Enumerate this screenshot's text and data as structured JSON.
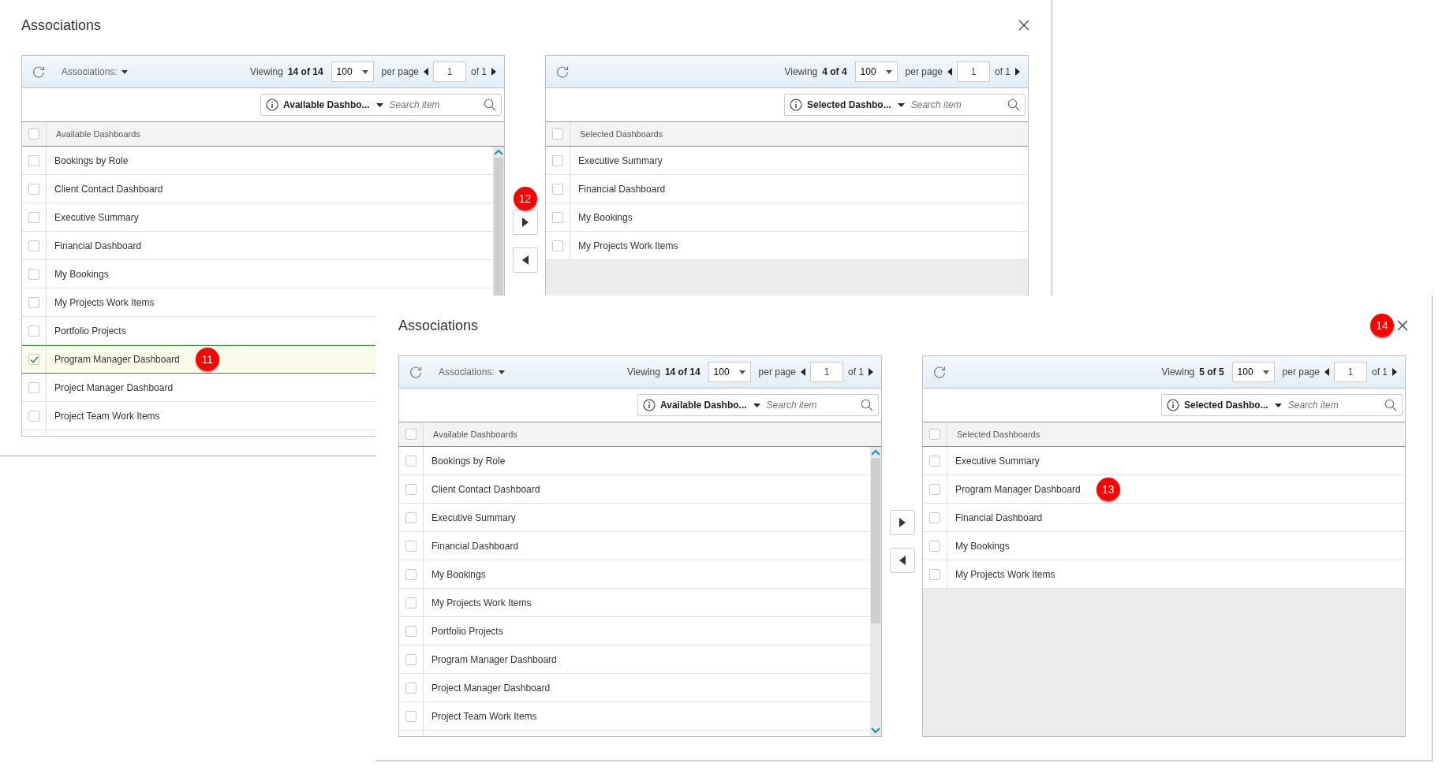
{
  "dialogs": [
    {
      "title": "Associations",
      "move_buttons": [
        {
          "kind": "right",
          "badge": "12"
        },
        {
          "kind": "left"
        }
      ],
      "panels": [
        {
          "kind": "available",
          "menu_label": "Associations:",
          "viewing_label": "Viewing",
          "count": "14 of 14",
          "per_page": "100",
          "per_page_label": "per page",
          "page": "1",
          "page_total": "of 1",
          "filter": "Available Dashbo...",
          "search": {
            "placeholder": "Search item"
          },
          "column": "Available Dashboards",
          "all_checked": false,
          "rows": [
            {
              "label": "Bookings by Role",
              "checked": false,
              "selected": false
            },
            {
              "label": "Client Contact Dashboard",
              "checked": false,
              "selected": false
            },
            {
              "label": "Executive Summary",
              "checked": false,
              "selected": false
            },
            {
              "label": "Financial Dashboard",
              "checked": false,
              "selected": false
            },
            {
              "label": "My Bookings",
              "checked": false,
              "selected": false
            },
            {
              "label": "My Projects Work Items",
              "checked": false,
              "selected": false
            },
            {
              "label": "Portfolio Projects",
              "checked": false,
              "selected": false
            },
            {
              "label": "Program Manager Dashboard",
              "checked": true,
              "selected": true,
              "badge": "11"
            },
            {
              "label": "Project Manager Dashboard",
              "checked": false,
              "selected": false
            },
            {
              "label": "Project Team Work Items",
              "checked": false,
              "selected": false
            }
          ]
        },
        {
          "kind": "selected",
          "viewing_label": "Viewing",
          "count": "4 of 4",
          "per_page": "100",
          "per_page_label": "per page",
          "page": "1",
          "page_total": "of 1",
          "filter": "Selected Dashbo...",
          "search": {
            "placeholder": "Search item"
          },
          "column": "Selected Dashboards",
          "all_checked": false,
          "rows": [
            {
              "label": "Executive Summary",
              "checked": false,
              "selected": false
            },
            {
              "label": "Financial Dashboard",
              "checked": false,
              "selected": false
            },
            {
              "label": "My Bookings",
              "checked": false,
              "selected": false
            },
            {
              "label": "My Projects Work Items",
              "checked": false,
              "selected": false
            }
          ]
        }
      ]
    },
    {
      "title": "Associations",
      "close_badge": "14",
      "move_buttons": [
        {
          "kind": "right"
        },
        {
          "kind": "left"
        }
      ],
      "panels": [
        {
          "kind": "available",
          "menu_label": "Associations:",
          "viewing_label": "Viewing",
          "count": "14 of 14",
          "per_page": "100",
          "per_page_label": "per page",
          "page": "1",
          "page_total": "of 1",
          "filter": "Available Dashbo...",
          "search": {
            "placeholder": "Search item"
          },
          "column": "Available Dashboards",
          "all_checked": false,
          "rows": [
            {
              "label": "Bookings by Role",
              "checked": false,
              "selected": false
            },
            {
              "label": "Client Contact Dashboard",
              "checked": false,
              "selected": false
            },
            {
              "label": "Executive Summary",
              "checked": false,
              "selected": false
            },
            {
              "label": "Financial Dashboard",
              "checked": false,
              "selected": false
            },
            {
              "label": "My Bookings",
              "checked": false,
              "selected": false
            },
            {
              "label": "My Projects Work Items",
              "checked": false,
              "selected": false
            },
            {
              "label": "Portfolio Projects",
              "checked": false,
              "selected": false
            },
            {
              "label": "Program Manager Dashboard",
              "checked": false,
              "selected": false
            },
            {
              "label": "Project Manager Dashboard",
              "checked": false,
              "selected": false
            },
            {
              "label": "Project Team Work Items",
              "checked": false,
              "selected": false
            }
          ]
        },
        {
          "kind": "selected",
          "viewing_label": "Viewing",
          "count": "5 of 5",
          "per_page": "100",
          "per_page_label": "per page",
          "page": "1",
          "page_total": "of 1",
          "filter": "Selected Dashbo...",
          "search": {
            "placeholder": "Search item"
          },
          "column": "Selected Dashboards",
          "all_checked": false,
          "rows": [
            {
              "label": "Executive Summary",
              "checked": false,
              "selected": false
            },
            {
              "label": "Program Manager Dashboard",
              "checked": false,
              "selected": false,
              "badge": "13"
            },
            {
              "label": "Financial Dashboard",
              "checked": false,
              "selected": false
            },
            {
              "label": "My Bookings",
              "checked": false,
              "selected": false
            },
            {
              "label": "My Projects Work Items",
              "checked": false,
              "selected": false
            }
          ]
        }
      ]
    }
  ]
}
